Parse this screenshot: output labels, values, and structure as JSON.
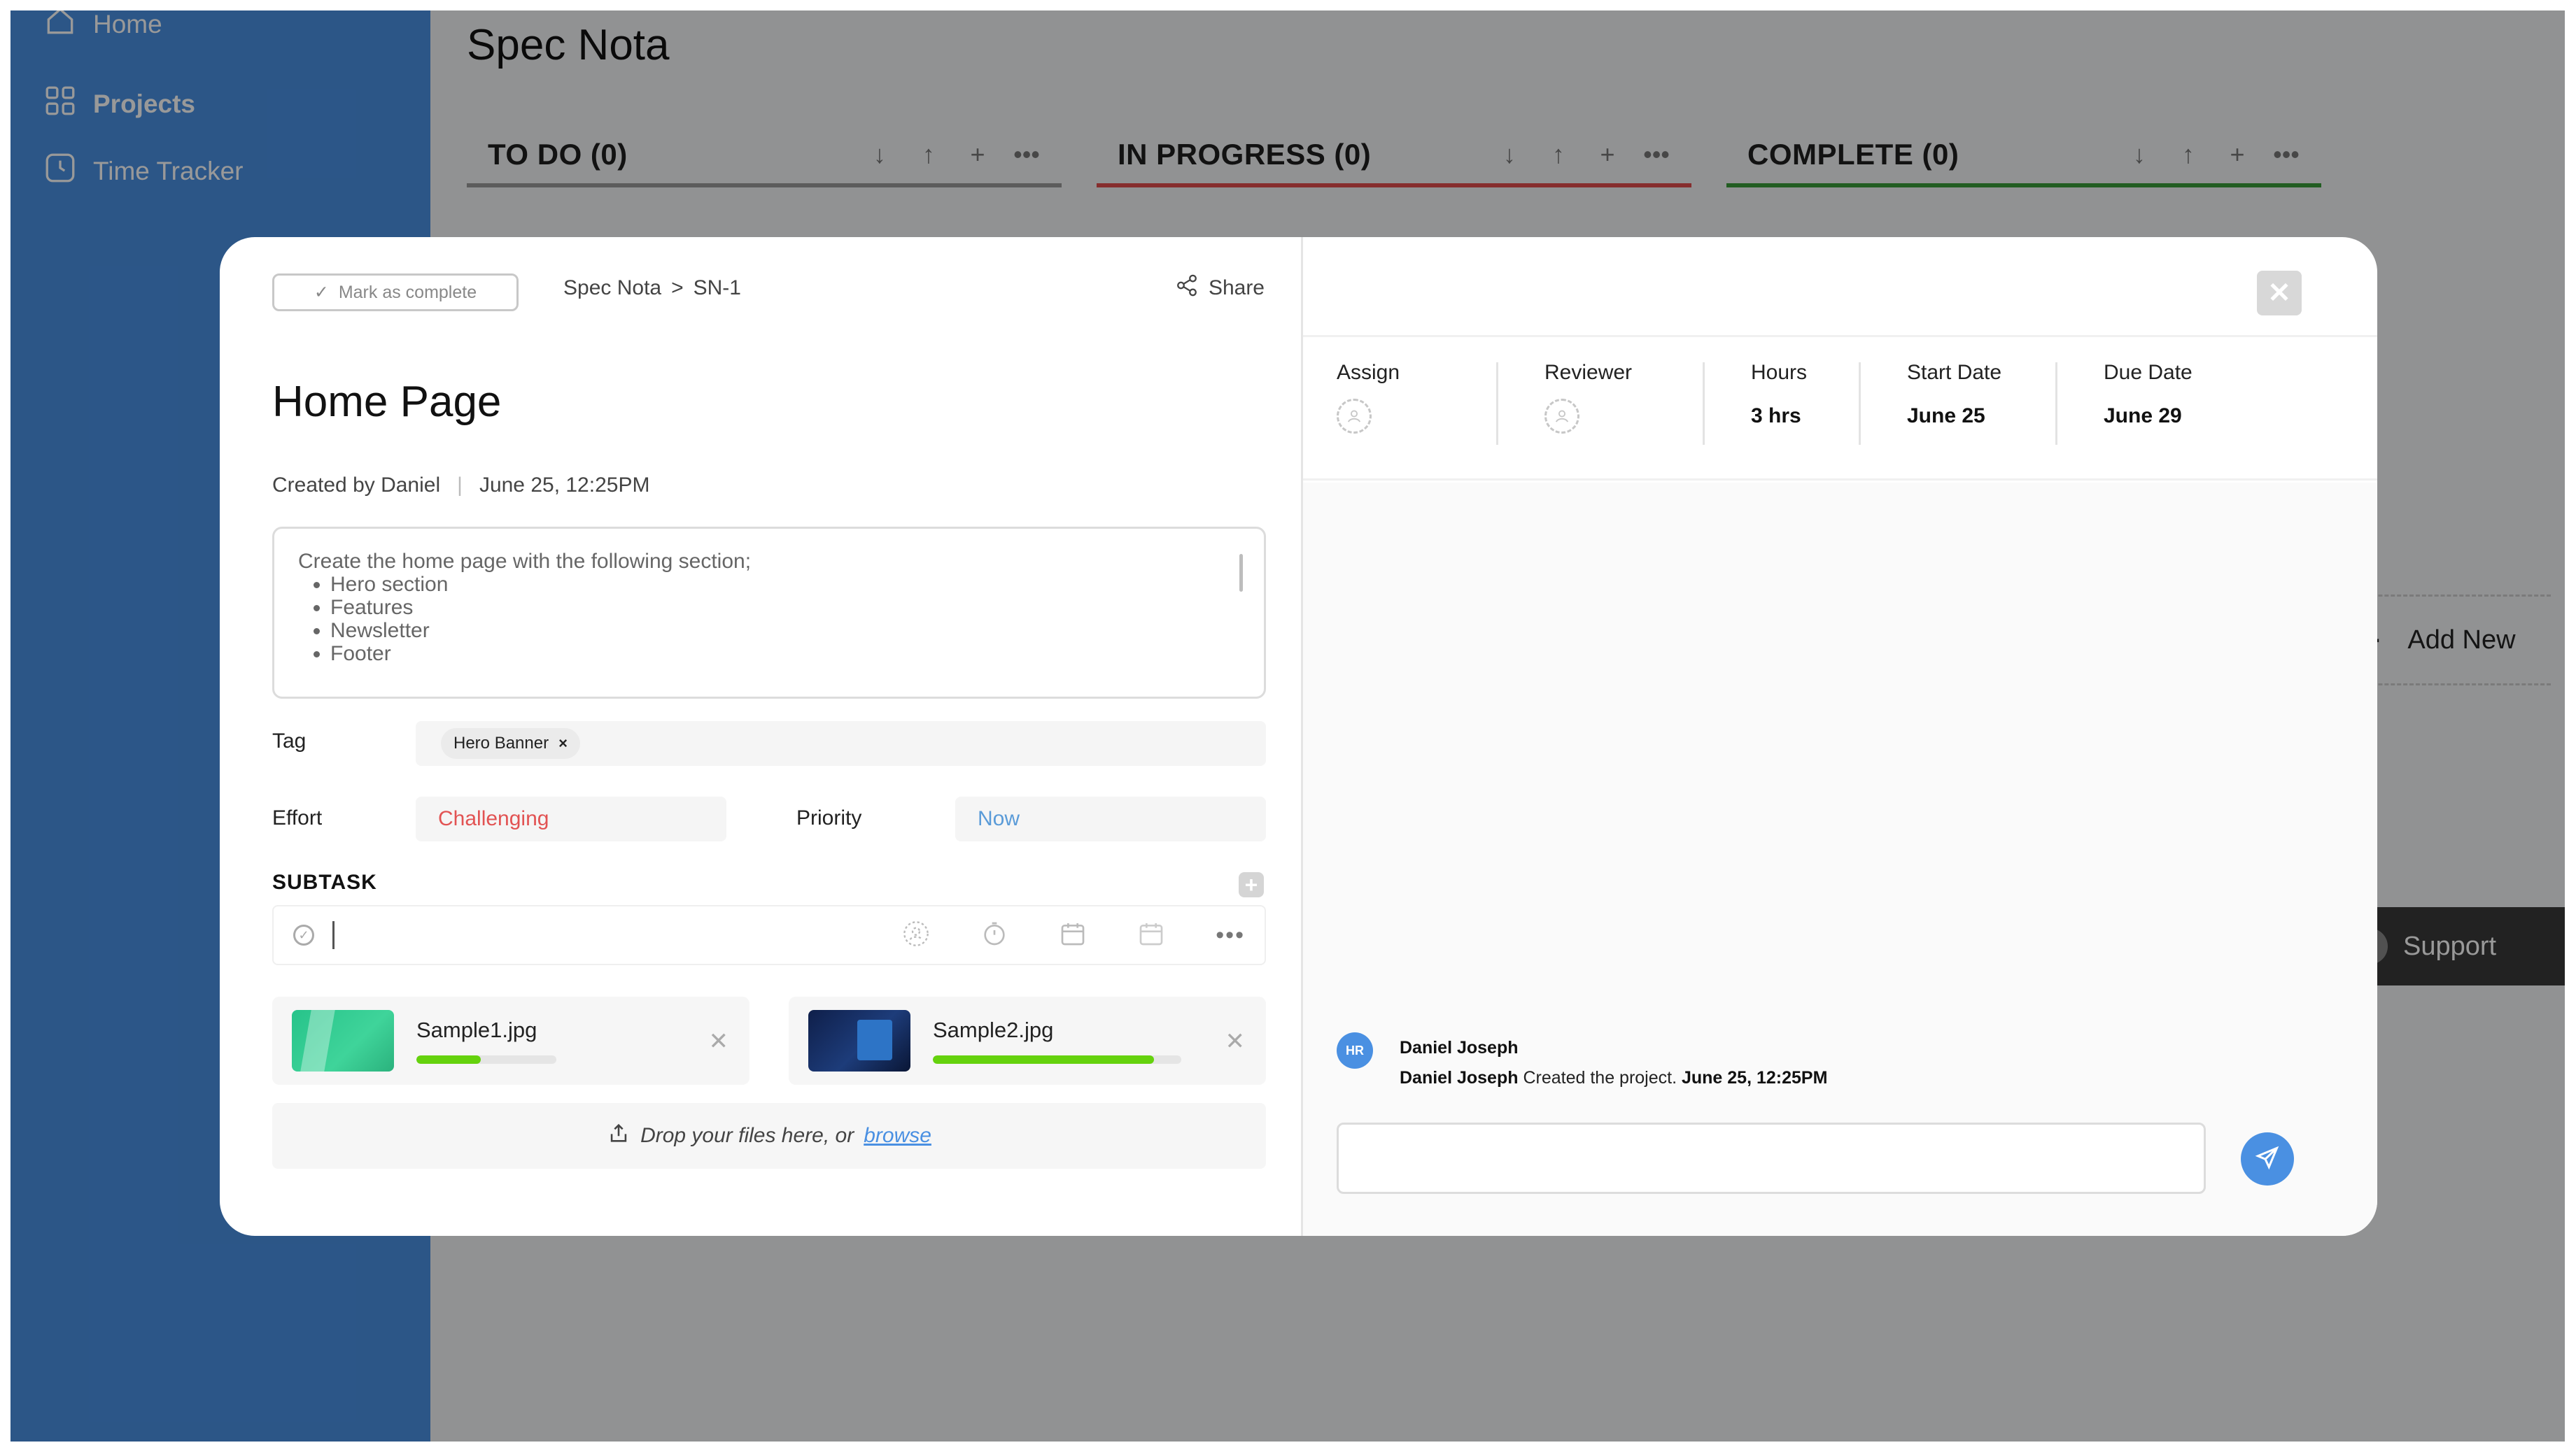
{
  "sidebar": {
    "items": [
      {
        "label": "Home",
        "icon": "home-icon"
      },
      {
        "label": "Projects",
        "icon": "grid-icon"
      },
      {
        "label": "Time Tracker",
        "icon": "clock-icon"
      }
    ]
  },
  "board": {
    "title": "Spec Nota",
    "columns": [
      {
        "name": "TO DO (0)",
        "color": "#999999"
      },
      {
        "name": "IN PROGRESS (0)",
        "color": "#e04b4b"
      },
      {
        "name": "COMPLETE (0)",
        "color": "#3a9b3a"
      }
    ],
    "add_new": "Add New",
    "support": "Support"
  },
  "task": {
    "mark_complete": "Mark as complete",
    "breadcrumb": {
      "project": "Spec Nota",
      "separator": ">",
      "id": "SN-1"
    },
    "share": "Share",
    "title": "Home Page",
    "created_by": "Created by Daniel",
    "created_sep": "|",
    "created_at": "June 25, 12:25PM",
    "description": {
      "intro": "Create the home page with the following section;",
      "items": [
        "Hero section",
        "Features",
        "Newsletter",
        "Footer"
      ]
    },
    "tag_label": "Tag",
    "tags": [
      "Hero Banner"
    ],
    "effort_label": "Effort",
    "effort_value": "Challenging",
    "priority_label": "Priority",
    "priority_value": "Now",
    "subtask_label": "SUBTASK",
    "files": [
      {
        "name": "Sample1.jpg",
        "progress": 0.46
      },
      {
        "name": "Sample2.jpg",
        "progress": 0.89
      }
    ],
    "dropzone": {
      "text": "Drop your files here, or",
      "link": "browse"
    }
  },
  "details": {
    "assign_label": "Assign",
    "reviewer_label": "Reviewer",
    "hours_label": "Hours",
    "hours_value": "3 hrs",
    "start_label": "Start Date",
    "start_value": "June 25",
    "due_label": "Due Date",
    "due_value": "June 29"
  },
  "activity": {
    "avatar_initials": "HR",
    "author": "Daniel Joseph",
    "actor": "Daniel Joseph",
    "action": "Created the project.",
    "time": "June 25, 12:25PM"
  },
  "colors": {
    "accent": "#4a90e2",
    "effort": "#e25353",
    "priority": "#5a9bd8",
    "progress": "#65d20d"
  }
}
